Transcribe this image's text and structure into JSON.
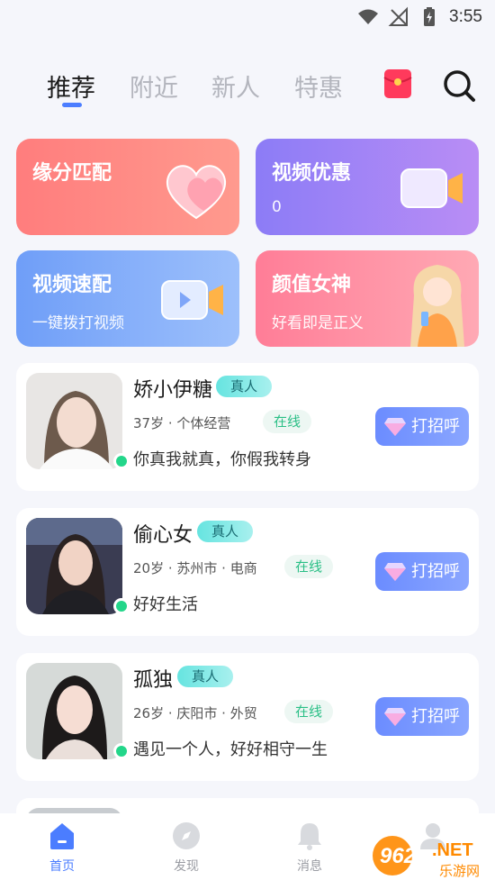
{
  "status_bar": {
    "time": "3:55"
  },
  "top_tabs": {
    "tabs": [
      {
        "label": "推荐",
        "active": true
      },
      {
        "label": "附近",
        "active": false
      },
      {
        "label": "新人",
        "active": false
      },
      {
        "label": "特惠",
        "active": false
      }
    ]
  },
  "features": [
    {
      "title": "缘分匹配",
      "subtitle": ""
    },
    {
      "title": "视频优惠",
      "subtitle": "0"
    },
    {
      "title": "视频速配",
      "subtitle": "一键拨打视频"
    },
    {
      "title": "颜值女神",
      "subtitle": "好看即是正义"
    }
  ],
  "users": [
    {
      "name": "娇小伊糖",
      "badge": "真人",
      "info": "37岁 · 个体经营",
      "status": "在线",
      "signature": "你真我就真，你假我转身",
      "button": "打招呼"
    },
    {
      "name": "偷心女",
      "badge": "真人",
      "info": "20岁 · 苏州市 · 电商",
      "status": "在线",
      "signature": "好好生活",
      "button": "打招呼"
    },
    {
      "name": "孤独",
      "badge": "真人",
      "info": "26岁 · 庆阳市 · 外贸",
      "status": "在线",
      "signature": "遇见一个人，好好相守一生",
      "button": "打招呼"
    }
  ],
  "bottom_nav": [
    {
      "label": "首页",
      "active": true
    },
    {
      "label": "发现",
      "active": false
    },
    {
      "label": "消息",
      "active": false
    }
  ],
  "watermark": {
    "text": "962.NET",
    "sub": "乐游网"
  },
  "colors": {
    "accent": "#4b7dff",
    "online": "#23d68a"
  }
}
